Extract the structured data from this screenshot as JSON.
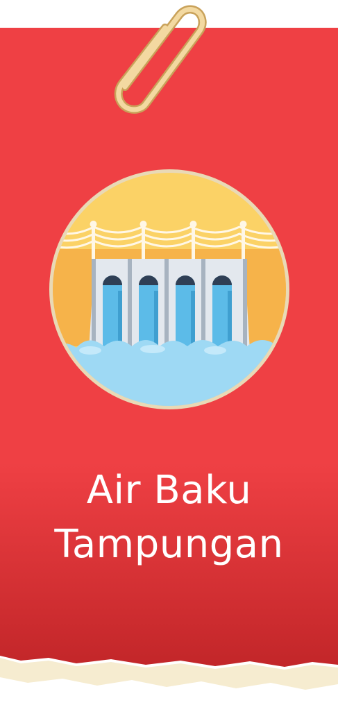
{
  "title": {
    "line1": "Air Baku",
    "line2": "Tampungan"
  },
  "icons": {
    "clip": "paperclip-icon",
    "emblem": "dam-icon"
  },
  "colors": {
    "card_red": "#ef4044",
    "card_red_dark": "#c9292d",
    "emblem_sky": "#fbd266",
    "emblem_band": "#f6b34a",
    "dam_wall": "#e3e8ee",
    "water": "#5cbbe8",
    "foam": "#9ed9f4",
    "paper_edge": "#f6ecd0",
    "text": "#ffffff"
  }
}
